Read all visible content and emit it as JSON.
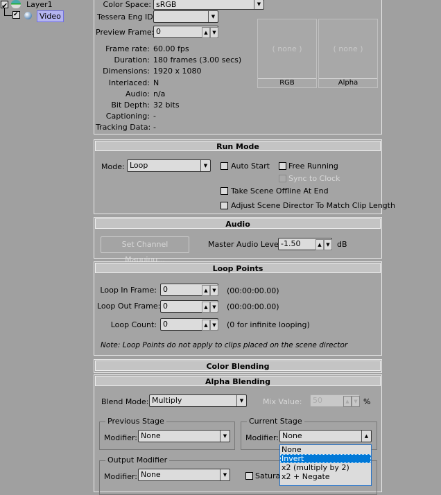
{
  "tree": {
    "layer": "Layer1",
    "video": "Video"
  },
  "top": {
    "color_space_label": "Color Space:",
    "color_space": "sRGB",
    "tessera_label": "Tessera Eng ID:",
    "tessera": "",
    "preview_label": "Preview Frame:",
    "preview": "0",
    "info": [
      [
        "Frame rate:",
        "60.00 fps"
      ],
      [
        "Duration:",
        "180 frames (3.00 secs)"
      ],
      [
        "Dimensions:",
        "1920 x 1080"
      ],
      [
        "Interlaced:",
        "N"
      ],
      [
        "Audio:",
        "n/a"
      ],
      [
        "Bit Depth:",
        "32 bits"
      ],
      [
        "Captioning:",
        "-"
      ],
      [
        "Tracking Data:",
        "-"
      ]
    ],
    "rgb_none": "( none )",
    "rgb_label": "RGB",
    "alpha_none": "( none )",
    "alpha_label": "Alpha"
  },
  "run": {
    "title": "Run Mode",
    "mode_label": "Mode:",
    "mode": "Loop",
    "auto_start": "Auto Start",
    "free_running": "Free Running",
    "sync": "Sync to Clock",
    "offline": "Take Scene Offline At End",
    "adjust": "Adjust Scene Director To Match Clip Length"
  },
  "audio": {
    "title": "Audio",
    "mapping": "Set Channel Mapping...",
    "level_label": "Master Audio Level:",
    "level": "-1.50",
    "unit": "dB"
  },
  "loop": {
    "title": "Loop Points",
    "in_label": "Loop In Frame:",
    "in": "0",
    "in_tc": "(00:00:00.00)",
    "out_label": "Loop Out Frame:",
    "out": "0",
    "out_tc": "(00:00:00.00)",
    "count_label": "Loop Count:",
    "count": "0",
    "count_note": "(0 for infinite looping)",
    "note": "Note: Loop Points do not apply to clips placed on the scene director"
  },
  "color": {
    "title": "Color Blending"
  },
  "alpha": {
    "title": "Alpha Blending",
    "blend_label": "Blend Mode:",
    "blend": "Multiply",
    "mix_label": "Mix Value:",
    "mix": "50",
    "pct": "%",
    "prev_stage": "Previous Stage",
    "cur_stage": "Current Stage",
    "output": "Output Modifier",
    "mod_label": "Modifier:",
    "prev_mod": "None",
    "cur_mod": "None",
    "out_mod": "None",
    "saturate": "Saturat",
    "options": [
      "None",
      "Invert",
      "x2 (multiply by 2)",
      "x2 + Negate"
    ],
    "selected": 1
  }
}
